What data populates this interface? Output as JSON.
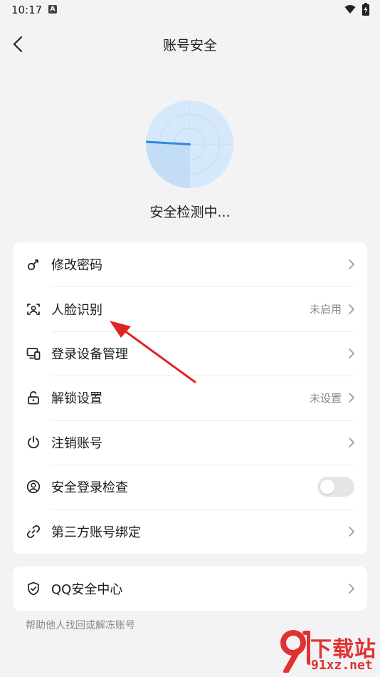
{
  "status_bar": {
    "time": "10:17",
    "notification_badge": "A"
  },
  "header": {
    "title": "账号安全"
  },
  "scan": {
    "status": "安全检测中..."
  },
  "security_items": [
    {
      "label": "修改密码",
      "value": "",
      "icon": "key-icon"
    },
    {
      "label": "人脸识别",
      "value": "未启用",
      "icon": "face-scan-icon"
    },
    {
      "label": "登录设备管理",
      "value": "",
      "icon": "devices-icon"
    },
    {
      "label": "解锁设置",
      "value": "未设置",
      "icon": "unlock-icon"
    },
    {
      "label": "注销账号",
      "value": "",
      "icon": "power-icon"
    },
    {
      "label": "安全登录检查",
      "value": "",
      "icon": "user-circle-icon",
      "toggle_on": false
    },
    {
      "label": "第三方账号绑定",
      "value": "",
      "icon": "link-icon"
    }
  ],
  "qq_center": {
    "label": "QQ安全中心",
    "icon": "shield-check-icon",
    "hint": "帮助他人找回或解冻账号"
  },
  "watermark": {
    "title": "下载站",
    "url": "91xz.net"
  },
  "colors": {
    "radar_blue": "#2b8ae0",
    "arrow_red": "#e02424",
    "background": "#f3f3f5",
    "watermark_red": "#e13232"
  }
}
